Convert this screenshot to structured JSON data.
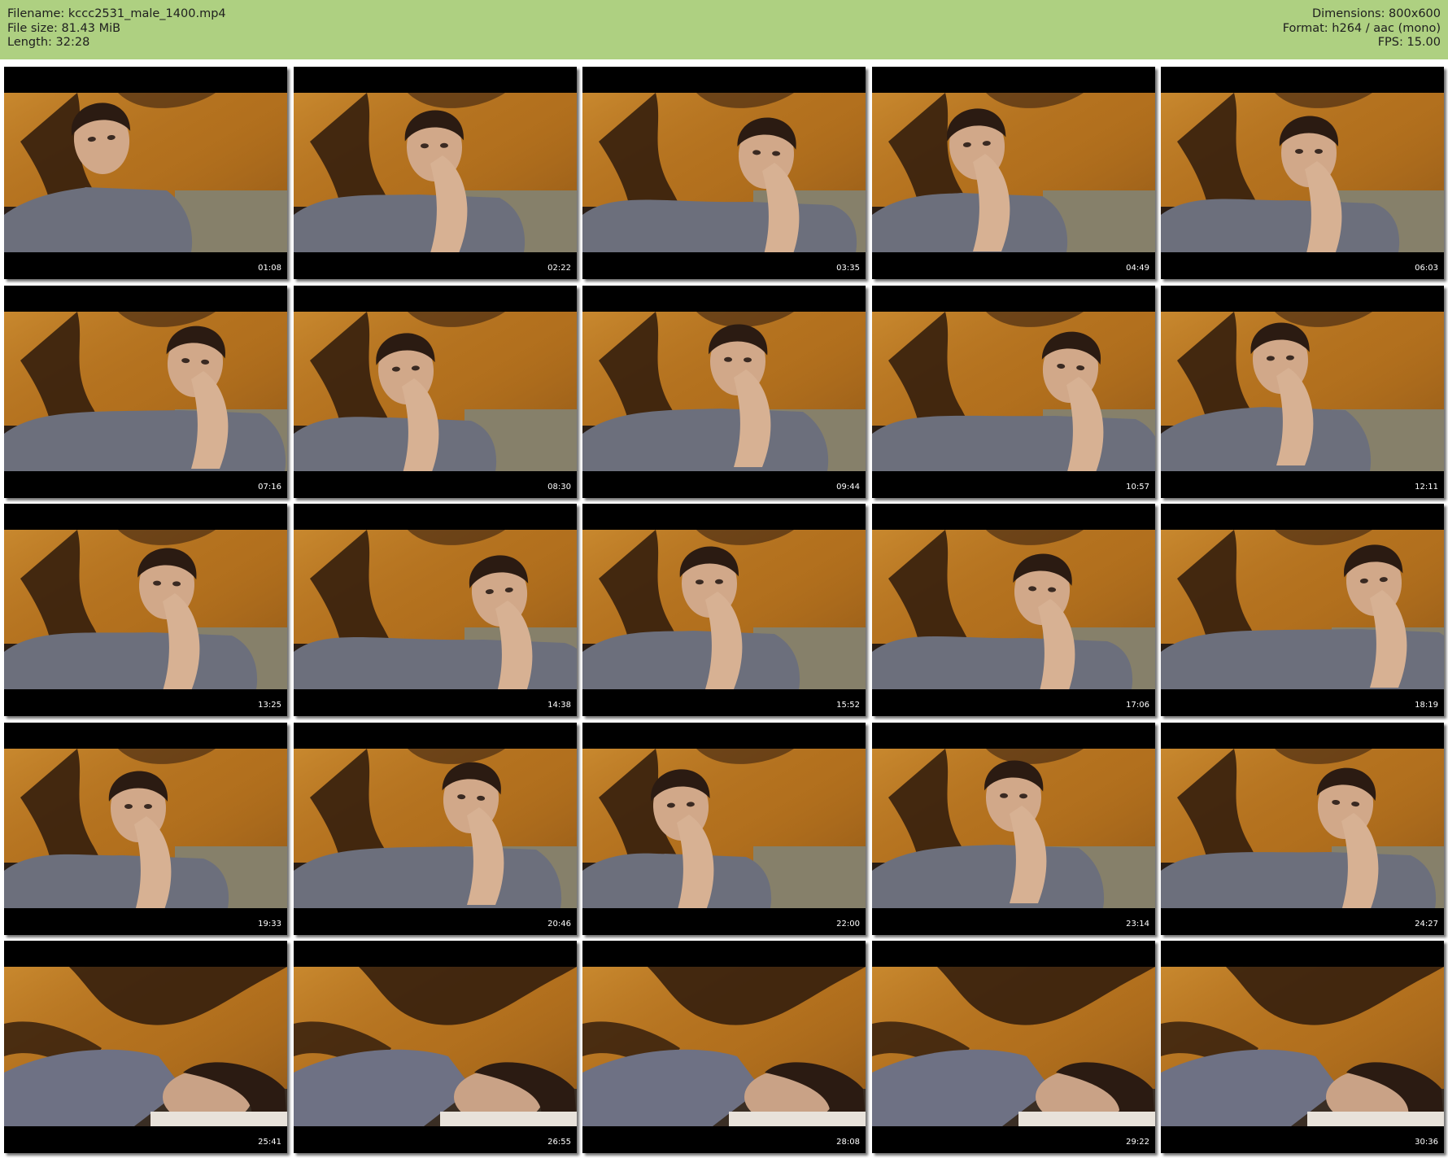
{
  "header": {
    "filename_line": "Filename: kccc2531_male_1400.mp4",
    "filesize_line": "File size: 81.43 MiB",
    "length_line": "Length: 32:28",
    "dimensions_line": "Dimensions: 800x600",
    "format_line": "Format: h264 / aac (mono)",
    "fps_line": "FPS: 15.00"
  },
  "colors": {
    "header_bg": "#aed081",
    "tile_bg": "#000000",
    "timestamp": "#ffffff"
  },
  "thumbnails": [
    {
      "timestamp": "01:08"
    },
    {
      "timestamp": "02:22"
    },
    {
      "timestamp": "03:35"
    },
    {
      "timestamp": "04:49"
    },
    {
      "timestamp": "06:03"
    },
    {
      "timestamp": "07:16"
    },
    {
      "timestamp": "08:30"
    },
    {
      "timestamp": "09:44"
    },
    {
      "timestamp": "10:57"
    },
    {
      "timestamp": "12:11"
    },
    {
      "timestamp": "13:25"
    },
    {
      "timestamp": "14:38"
    },
    {
      "timestamp": "15:52"
    },
    {
      "timestamp": "17:06"
    },
    {
      "timestamp": "18:19"
    },
    {
      "timestamp": "19:33"
    },
    {
      "timestamp": "20:46"
    },
    {
      "timestamp": "22:00"
    },
    {
      "timestamp": "23:14"
    },
    {
      "timestamp": "24:27"
    },
    {
      "timestamp": "25:41"
    },
    {
      "timestamp": "26:55"
    },
    {
      "timestamp": "28:08"
    },
    {
      "timestamp": "29:22"
    },
    {
      "timestamp": "30:36"
    }
  ]
}
